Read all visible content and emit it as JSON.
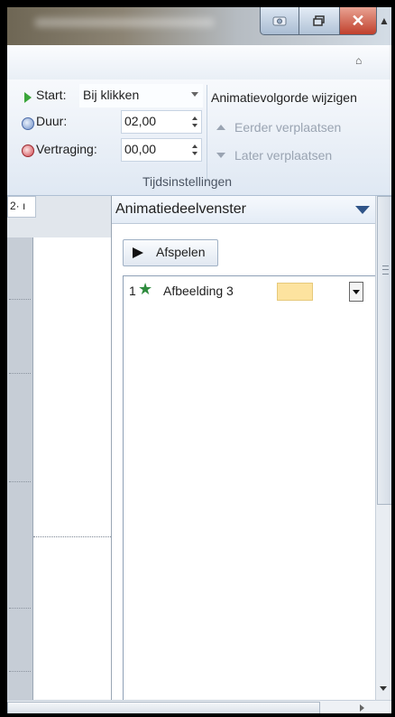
{
  "ribbon": {
    "start_label": "Start:",
    "start_value": "Bij klikken",
    "duration_label": "Duur:",
    "duration_value": "02,00",
    "delay_label": "Vertraging:",
    "delay_value": "00,00",
    "reorder_title": "Animatievolgorde wijzigen",
    "move_earlier": "Eerder verplaatsen",
    "move_later": "Later verplaatsen",
    "group_label": "Tijdsinstellingen"
  },
  "slide": {
    "ruler_text": "2· ı"
  },
  "animation_pane": {
    "title": "Animatiedeelvenster",
    "play_label": "Afspelen",
    "items": [
      {
        "number": "1",
        "name": "Afbeelding 3",
        "icon": "entrance-effect-star-icon",
        "timing_color": "#fde39f"
      }
    ]
  },
  "colors": {
    "ribbon_bg": "#e9eff6",
    "pane_header_bg": "#e4ecf6",
    "close_button": "#c0402c",
    "accent_blue": "#2f5488"
  }
}
